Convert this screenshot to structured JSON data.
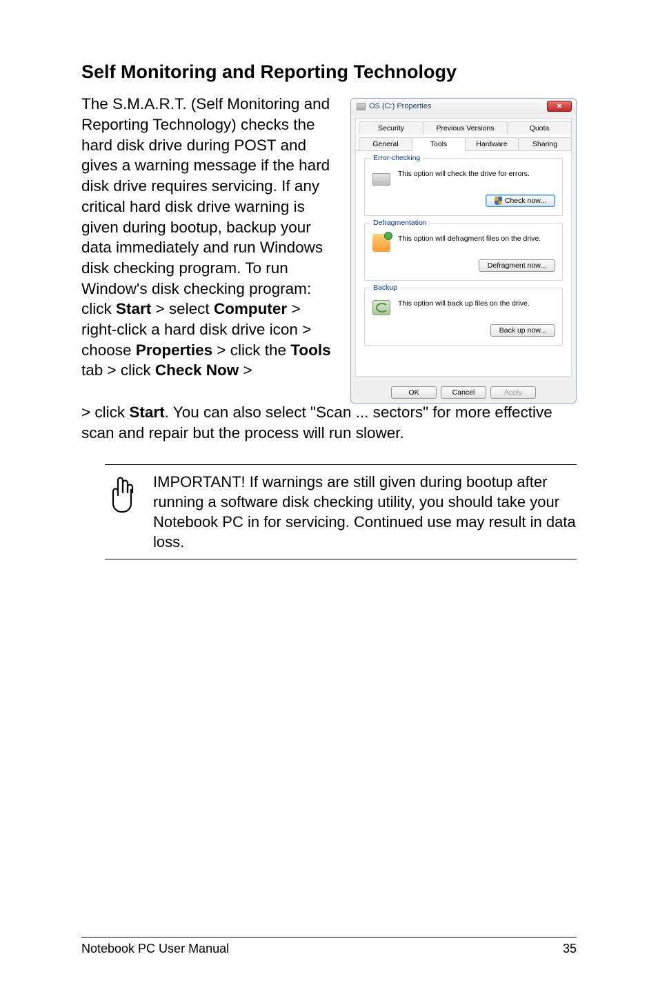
{
  "heading": "Self Monitoring and Reporting Technology",
  "body_left": "The S.M.A.R.T. (Self Monitoring and Reporting Technology) checks the hard disk drive during POST and gives a warning message if the hard disk drive requires servicing. If any critical hard disk drive warning is given during bootup, backup your data immediately and run Windows disk checking program. To run Window's disk checking program: click ",
  "b_start": "Start",
  "body_mid1": " > select ",
  "b_computer": "Computer",
  "body_mid2": " > right-click a hard disk drive icon > choose ",
  "b_properties": "Properties",
  "body_mid3": " > click the ",
  "b_tools": "Tools",
  "body_mid4": " tab > click ",
  "b_checknow": "Check Now",
  "body_mid5": " > click ",
  "b_start2": "Start",
  "body_after": ". You can also select \"Scan ... sectors\" for more effective scan and repair but the process will run slower.",
  "dialog": {
    "title": "OS (C:) Properties",
    "close": "✕",
    "tabs_row1": {
      "security": "Security",
      "previous": "Previous Versions",
      "quota": "Quota"
    },
    "tabs_row2": {
      "general": "General",
      "tools": "Tools",
      "hardware": "Hardware",
      "sharing": "Sharing"
    },
    "error_checking": {
      "legend": "Error-checking",
      "text": "This option will check the drive for errors.",
      "button": "Check now..."
    },
    "defrag": {
      "legend": "Defragmentation",
      "text": "This option will defragment files on the drive.",
      "button": "Defragment now..."
    },
    "backup": {
      "legend": "Backup",
      "text": "This option will back up files on the drive.",
      "button": "Back up now..."
    },
    "ok": "OK",
    "cancel": "Cancel",
    "apply": "Apply"
  },
  "note": "IMPORTANT! If warnings are still given during bootup after running a software disk checking utility, you should take your Notebook PC in for servicing. Continued use may result in data loss.",
  "footer_left": "Notebook PC User Manual",
  "footer_right": "35"
}
